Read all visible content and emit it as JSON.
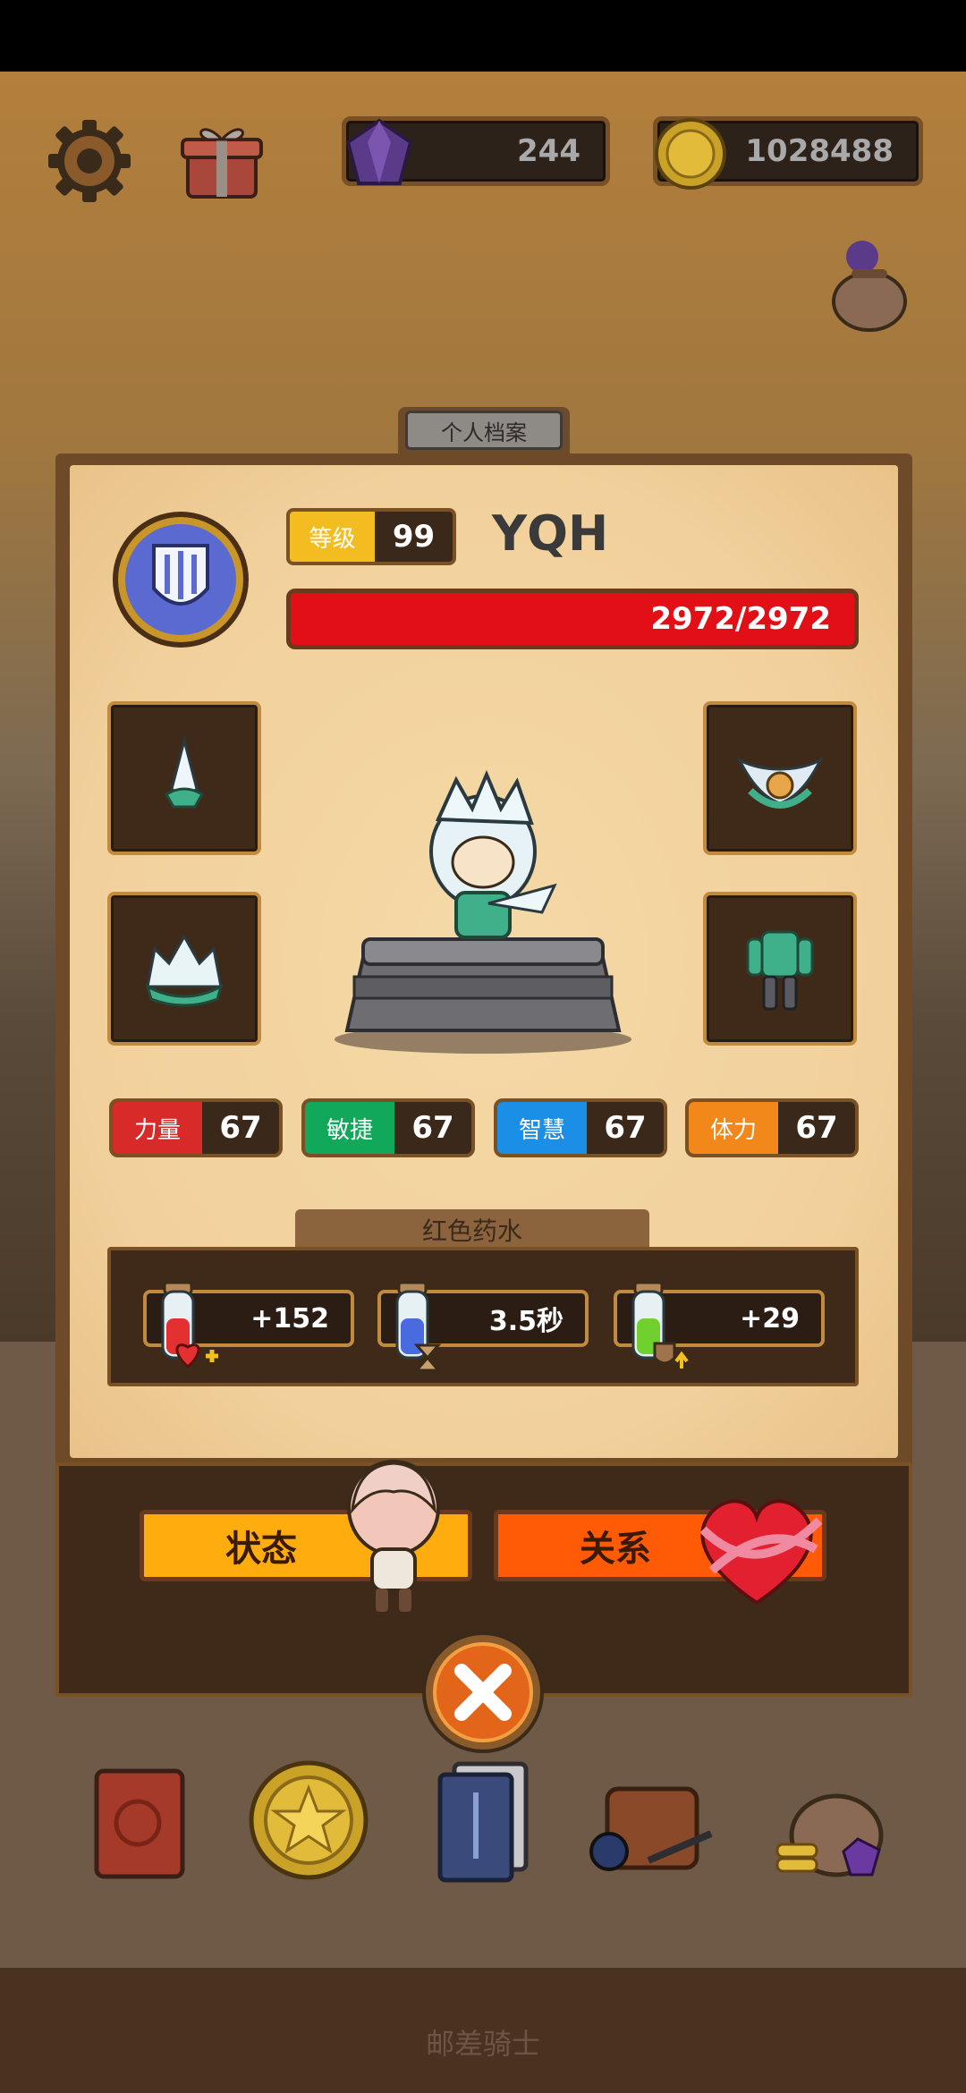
{
  "top_bar": {
    "gems": "244",
    "gold": "1028488"
  },
  "profile": {
    "tab_title": "个人档案",
    "level_label": "等级",
    "level_value": "99",
    "name": "YQH",
    "hp": "2972/2972"
  },
  "stats": [
    {
      "label": "力量",
      "value": "67",
      "color": "#d92a2a"
    },
    {
      "label": "敏捷",
      "value": "67",
      "color": "#12a85a"
    },
    {
      "label": "智慧",
      "value": "67",
      "color": "#1b8ee6"
    },
    {
      "label": "体力",
      "value": "67",
      "color": "#f2881a"
    }
  ],
  "potions": {
    "title": "红色药水",
    "items": [
      {
        "value": "+152",
        "icon": "red-potion-heart-icon"
      },
      {
        "value": "3.5秒",
        "icon": "blue-potion-hourglass-icon"
      },
      {
        "value": "+29",
        "icon": "green-potion-shield-icon"
      }
    ]
  },
  "actions": {
    "status": "状态",
    "relation": "关系"
  },
  "nav": [
    "book-icon",
    "star-coin-icon",
    "cards-icon",
    "bag-icon",
    "treasure-sack-icon"
  ],
  "footer": "邮差骑士",
  "colors": {
    "hp_bar": "#e30f16",
    "status_button": "#ffac0f",
    "relation_button": "#ff5a06"
  }
}
